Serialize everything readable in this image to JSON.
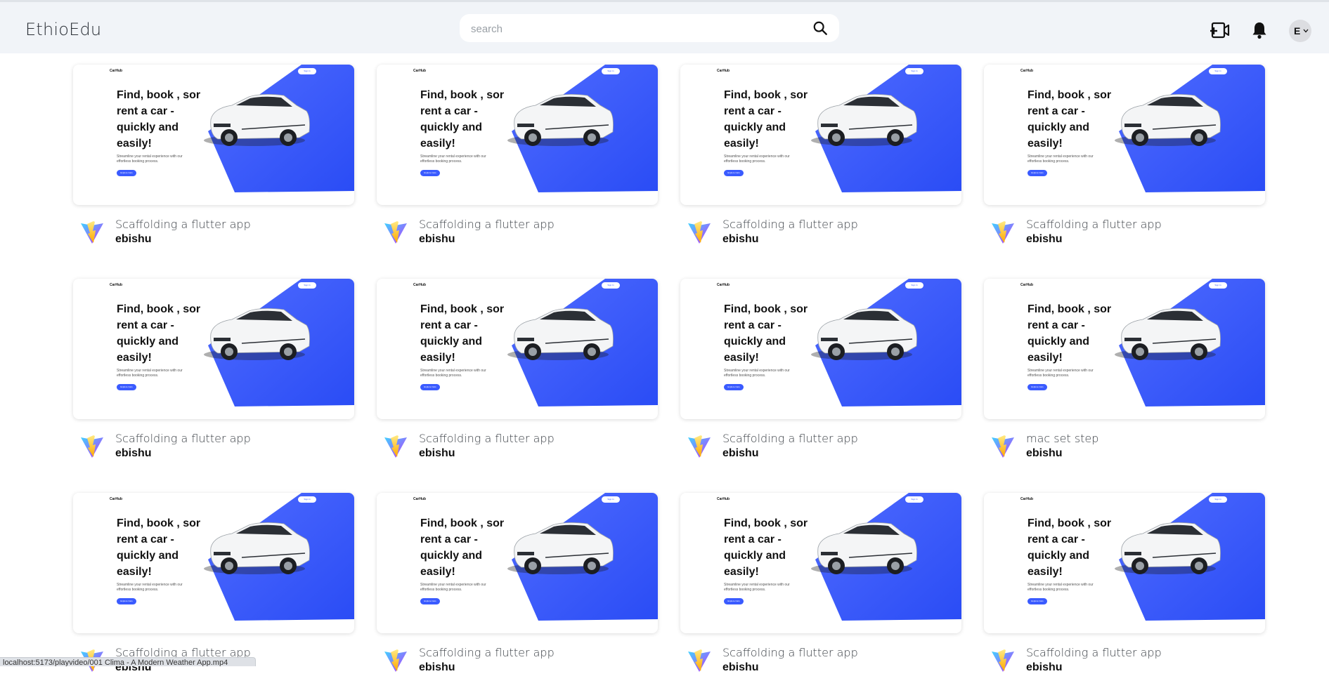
{
  "app": {
    "brand": "EthioEdu"
  },
  "search": {
    "placeholder": "search"
  },
  "header_icons": [
    "search-icon",
    "video-add-icon",
    "bell-icon",
    "chevron-down-icon"
  ],
  "user": {
    "avatar_initial": "E"
  },
  "colors": {
    "accent_blue": "#3a5bff",
    "header_bg": "#f1f4f8"
  },
  "thumbnail": {
    "logo": "CarHub",
    "headline": "Find, book , sor rent a car - quickly and easily!",
    "subtext": "Streamline your rental experience with our effortless booking process.",
    "cta": "Explore Cars",
    "sign_in": "Sign In"
  },
  "videos": [
    {
      "title": "Scaffolding a flutter app",
      "author": "ebishu"
    },
    {
      "title": "Scaffolding a flutter app",
      "author": "ebishu"
    },
    {
      "title": "Scaffolding a flutter app",
      "author": "ebishu"
    },
    {
      "title": "Scaffolding a flutter app",
      "author": "ebishu"
    },
    {
      "title": "Scaffolding a flutter app",
      "author": "ebishu"
    },
    {
      "title": "Scaffolding a flutter app",
      "author": "ebishu"
    },
    {
      "title": "Scaffolding a flutter app",
      "author": "ebishu"
    },
    {
      "title": "mac set step",
      "author": "ebishu"
    },
    {
      "title": "Scaffolding a flutter app",
      "author": "ebishu"
    },
    {
      "title": "Scaffolding a flutter app",
      "author": "ebishu"
    },
    {
      "title": "Scaffolding a flutter app",
      "author": "ebishu"
    },
    {
      "title": "Scaffolding a flutter app",
      "author": "ebishu"
    }
  ],
  "status_bar": {
    "url": "localhost:5173/playvideo/001 Clima - A Modern Weather App.mp4"
  }
}
